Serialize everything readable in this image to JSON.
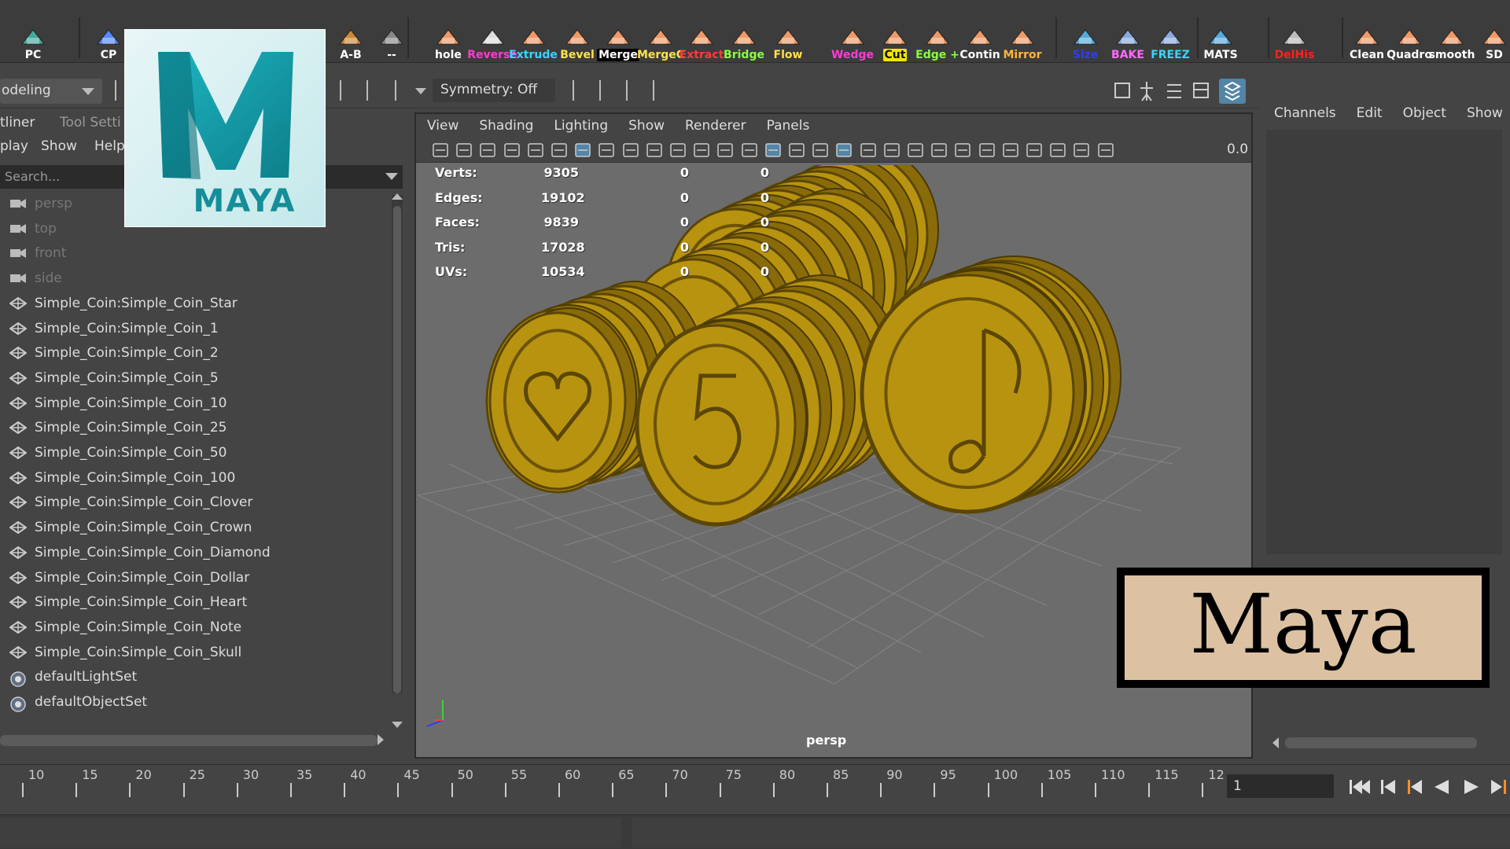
{
  "shelf": {
    "buttons": [
      {
        "label": "PC",
        "color": "#ffffff"
      },
      {
        "label": "CP",
        "color": "#ffffff"
      },
      {
        "label": "A-B",
        "color": "#ffffff"
      },
      {
        "label": "--",
        "color": "#ffffff"
      },
      {
        "label": "hole",
        "color": "#ffffff"
      },
      {
        "label": "Reverse",
        "color": "#ff3bd2"
      },
      {
        "label": "Extrude",
        "color": "#39d4ff"
      },
      {
        "label": "Bevel",
        "color": "#ffe34a"
      },
      {
        "label": "Merge",
        "color": "#ffffff",
        "bg": "#000000"
      },
      {
        "label": "MergeC",
        "color": "#ffe34a"
      },
      {
        "label": "Extract",
        "color": "#ff3b3b"
      },
      {
        "label": "Bridge",
        "color": "#8bff3b"
      },
      {
        "label": "Flow",
        "color": "#ffe34a"
      },
      {
        "label": "Wedge",
        "color": "#ff3bd2"
      },
      {
        "label": "Cut",
        "color": "#111111",
        "bg": "#f2e600"
      },
      {
        "label": "Edge +",
        "color": "#8bff3b"
      },
      {
        "label": "Contin",
        "color": "#ffffff"
      },
      {
        "label": "Mirror",
        "color": "#ffb43b"
      },
      {
        "label": "Size",
        "color": "#2f3bff"
      },
      {
        "label": "BAKE",
        "color": "#ff6bff"
      },
      {
        "label": "FREEZ",
        "color": "#39d4ff"
      },
      {
        "label": "MATS",
        "color": "#ffffff"
      },
      {
        "label": "DelHis",
        "color": "#ff2020"
      },
      {
        "label": "Clean",
        "color": "#ffffff"
      },
      {
        "label": "Quadro",
        "color": "#ffffff"
      },
      {
        "label": "smooth",
        "color": "#ffffff"
      },
      {
        "label": "SD",
        "color": "#ffffff"
      }
    ]
  },
  "statusline": {
    "mode": "odeling",
    "symmetry": "Symmetry: Off"
  },
  "outliner": {
    "tabs": [
      "tliner",
      "Tool Setti"
    ],
    "menu": [
      "play",
      "Show",
      "Help"
    ],
    "search_placeholder": "Search...",
    "items": [
      {
        "label": "persp",
        "type": "camera"
      },
      {
        "label": "top",
        "type": "camera"
      },
      {
        "label": "front",
        "type": "camera"
      },
      {
        "label": "side",
        "type": "camera"
      },
      {
        "label": "Simple_Coin:Simple_Coin_Star",
        "type": "mesh"
      },
      {
        "label": "Simple_Coin:Simple_Coin_1",
        "type": "mesh"
      },
      {
        "label": "Simple_Coin:Simple_Coin_2",
        "type": "mesh"
      },
      {
        "label": "Simple_Coin:Simple_Coin_5",
        "type": "mesh"
      },
      {
        "label": "Simple_Coin:Simple_Coin_10",
        "type": "mesh"
      },
      {
        "label": "Simple_Coin:Simple_Coin_25",
        "type": "mesh"
      },
      {
        "label": "Simple_Coin:Simple_Coin_50",
        "type": "mesh"
      },
      {
        "label": "Simple_Coin:Simple_Coin_100",
        "type": "mesh"
      },
      {
        "label": "Simple_Coin:Simple_Coin_Clover",
        "type": "mesh"
      },
      {
        "label": "Simple_Coin:Simple_Coin_Crown",
        "type": "mesh"
      },
      {
        "label": "Simple_Coin:Simple_Coin_Diamond",
        "type": "mesh"
      },
      {
        "label": "Simple_Coin:Simple_Coin_Dollar",
        "type": "mesh"
      },
      {
        "label": "Simple_Coin:Simple_Coin_Heart",
        "type": "mesh"
      },
      {
        "label": "Simple_Coin:Simple_Coin_Note",
        "type": "mesh"
      },
      {
        "label": "Simple_Coin:Simple_Coin_Skull",
        "type": "mesh"
      },
      {
        "label": "defaultLightSet",
        "type": "set"
      },
      {
        "label": "defaultObjectSet",
        "type": "set"
      }
    ]
  },
  "logo": {
    "text": "MAYA"
  },
  "viewport": {
    "menu": [
      "View",
      "Shading",
      "Lighting",
      "Show",
      "Renderer",
      "Panels"
    ],
    "field_value": "0.0",
    "camera_label": "persp",
    "hud": [
      {
        "label": "Verts:",
        "values": [
          "9305",
          "0",
          "0"
        ]
      },
      {
        "label": "Edges:",
        "values": [
          "19102",
          "0",
          "0"
        ]
      },
      {
        "label": "Faces:",
        "values": [
          "9839",
          "0",
          "0"
        ]
      },
      {
        "label": "Tris:",
        "values": [
          "17028",
          "0",
          "0"
        ]
      },
      {
        "label": "UVs:",
        "values": [
          "10534",
          "0",
          "0"
        ]
      }
    ],
    "coin_color": "#b8930f"
  },
  "channelbox": {
    "menu": [
      "Channels",
      "Edit",
      "Object",
      "Show"
    ]
  },
  "timeslider": {
    "ticks": [
      "10",
      "15",
      "20",
      "25",
      "30",
      "35",
      "40",
      "45",
      "50",
      "55",
      "60",
      "65",
      "70",
      "75",
      "80",
      "85",
      "90",
      "95",
      "100",
      "105",
      "110",
      "115",
      "12"
    ],
    "current_frame": "1"
  },
  "sign": {
    "text": "Maya"
  }
}
